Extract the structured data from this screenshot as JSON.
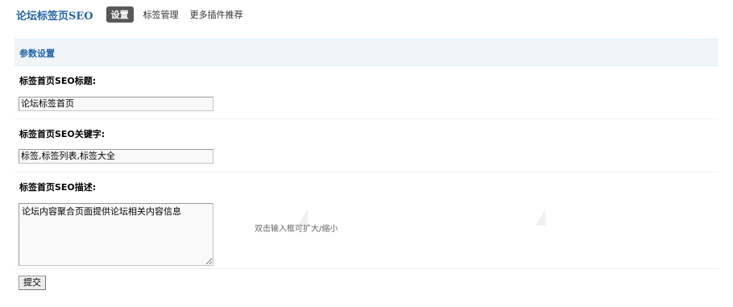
{
  "header": {
    "title": "论坛标签页SEO",
    "tabs": [
      {
        "label": "设置",
        "active": true
      },
      {
        "label": "标签管理",
        "active": false
      },
      {
        "label": "更多插件推荐",
        "active": false
      }
    ]
  },
  "section": {
    "title": "参数设置"
  },
  "form": {
    "seo_title": {
      "label": "标签首页SEO标题:",
      "value": "论坛标签首页"
    },
    "seo_keywords": {
      "label": "标签首页SEO关键字:",
      "value": "标签,标签列表,标签大全"
    },
    "seo_description": {
      "label": "标签首页SEO描述:",
      "value": "论坛内容聚合页面提供论坛相关内容信息",
      "hint": "双击输入框可扩大/缩小"
    },
    "submit_label": "提交"
  },
  "colors": {
    "brand": "#2366A8",
    "section_bg": "#F1F5FA",
    "active_tab_bg": "#585858"
  }
}
